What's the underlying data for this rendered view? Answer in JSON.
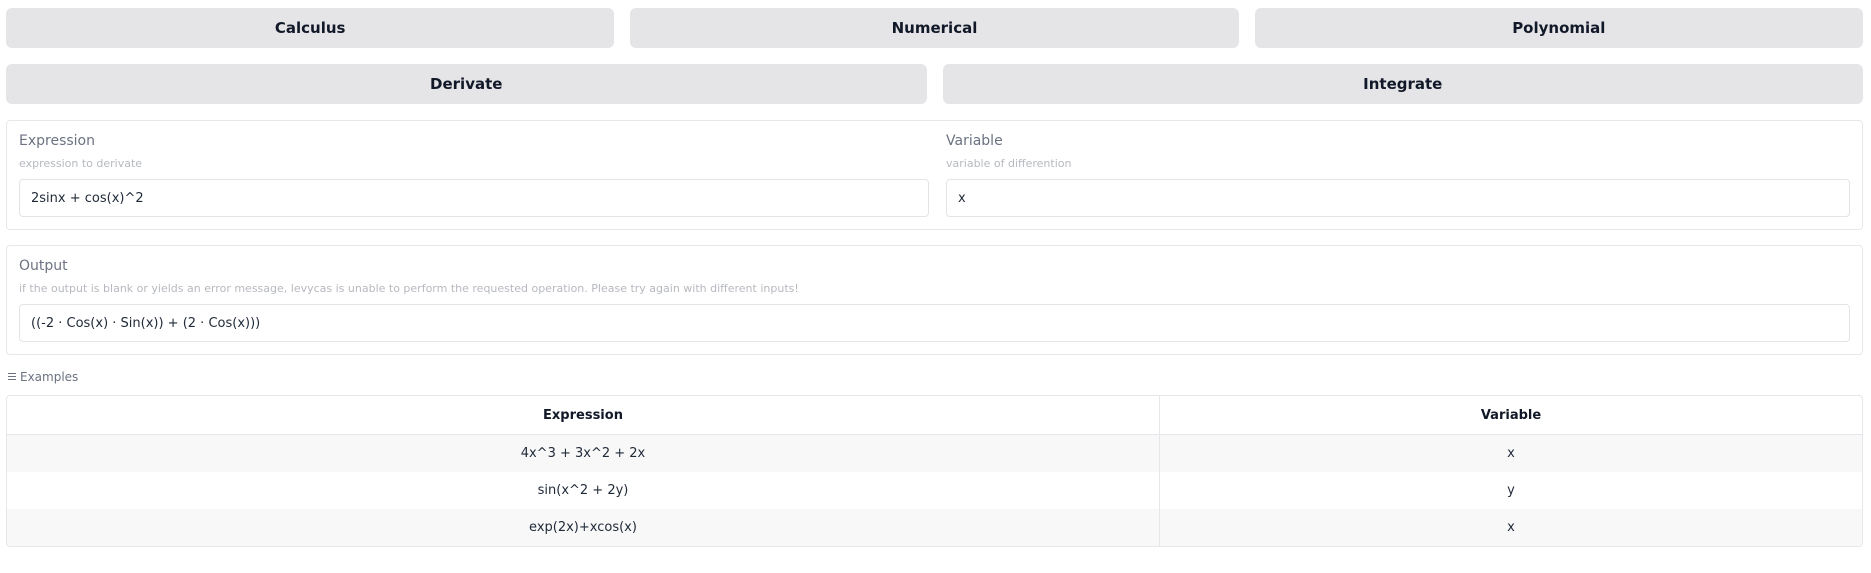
{
  "top_tabs": [
    "Calculus",
    "Numerical",
    "Polynomial"
  ],
  "sub_tabs": [
    "Derivate",
    "Integrate"
  ],
  "inputs": {
    "expression": {
      "label": "Expression",
      "info": "expression to derivate",
      "value": "2sinx + cos(x)^2"
    },
    "variable": {
      "label": "Variable",
      "info": "variable of differention",
      "value": "x"
    }
  },
  "output": {
    "label": "Output",
    "info": "if the output is blank or yields an error message, levycas is unable to perform the requested operation. Please try again with different inputs!",
    "value": "((-2 · Cos(x) · Sin(x)) + (2 · Cos(x)))"
  },
  "examples": {
    "title": "Examples",
    "headers": [
      "Expression",
      "Variable"
    ],
    "rows": [
      [
        "4x^3 + 3x^2 + 2x",
        "x"
      ],
      [
        "sin(x^2 + 2y)",
        "y"
      ],
      [
        "exp(2x)+xcos(x)",
        "x"
      ]
    ]
  }
}
